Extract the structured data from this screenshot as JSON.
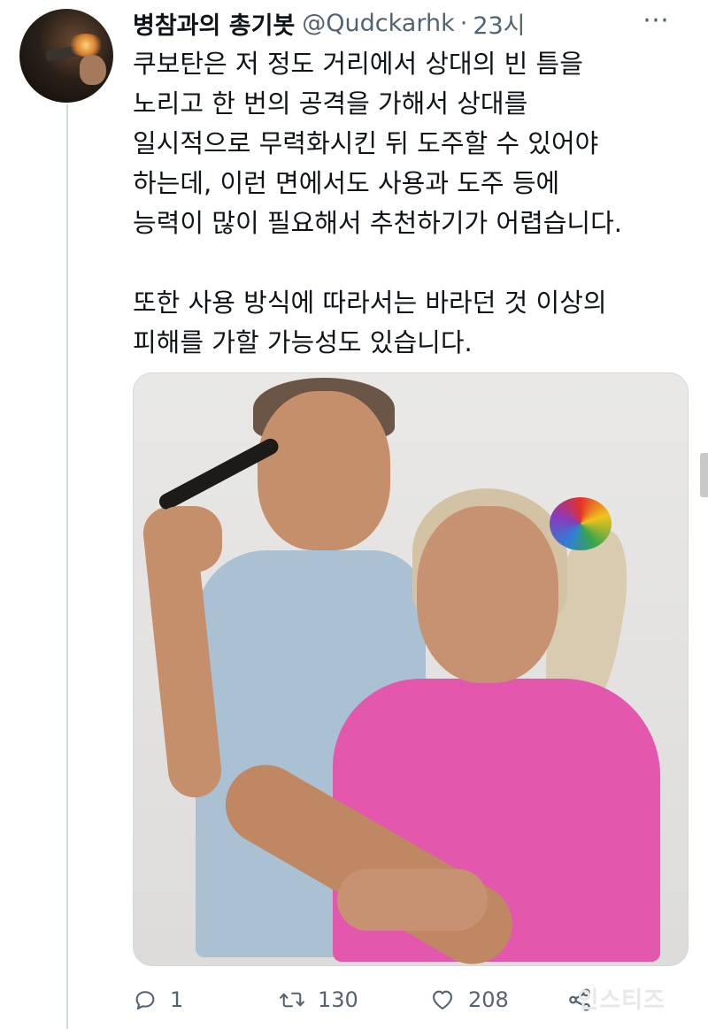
{
  "tweet": {
    "author": {
      "display_name": "병참과의 총기봇",
      "handle": "@Qudckarhk",
      "separator": "·",
      "time": "23시"
    },
    "more_label": "⋯",
    "text": {
      "paragraph1_lines": [
        "쿠보탄은 저 정도 거리에서 상대의 빈 틈을",
        "노리고 한 번의 공격을 가해서 상대를",
        "일시적으로 무력화시킨 뒤 도주할 수 있어야",
        "하는데, 이런 면에서도 사용과 도주 등에",
        "능력이 많이 필요해서 추천하기가 어렵습니다."
      ],
      "paragraph2_lines": [
        "또한 사용 방식에 따라서는 바라던 것 이상의",
        "피해를 가할 가능성도 있습니다."
      ]
    },
    "actions": {
      "reply_count": "1",
      "retweet_count": "130",
      "like_count": "208"
    },
    "icons": {
      "reply": "reply-icon",
      "retweet": "retweet-icon",
      "like": "heart-icon",
      "share": "share-icon",
      "more": "more-icon"
    },
    "colors": {
      "text": "#0f1419",
      "secondary": "#536471",
      "border": "#cfd9de",
      "shirt_pink": "#e357ac"
    }
  },
  "watermark": "인스티즈"
}
